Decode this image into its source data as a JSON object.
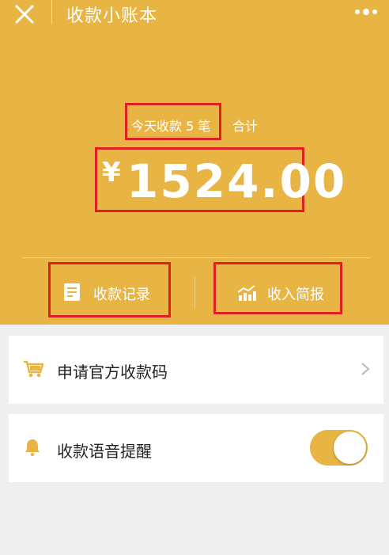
{
  "header": {
    "title": "收款小账本"
  },
  "summary": {
    "count_text": "今天收款 5 笔",
    "total_label": "合计",
    "currency": "¥",
    "amount": "1524.00"
  },
  "actions": {
    "records_label": "收款记录",
    "report_label": "收入简报"
  },
  "menu": {
    "apply_qr_label": "申请官方收款码",
    "voice_alert_label": "收款语音提醒",
    "voice_alert_on": true
  },
  "colors": {
    "accent": "#e8b545",
    "highlight": "#e02020"
  },
  "icons": [
    "close-icon",
    "more-icon",
    "document-icon",
    "chart-icon",
    "cart-icon",
    "chevron-right-icon",
    "bell-icon"
  ]
}
